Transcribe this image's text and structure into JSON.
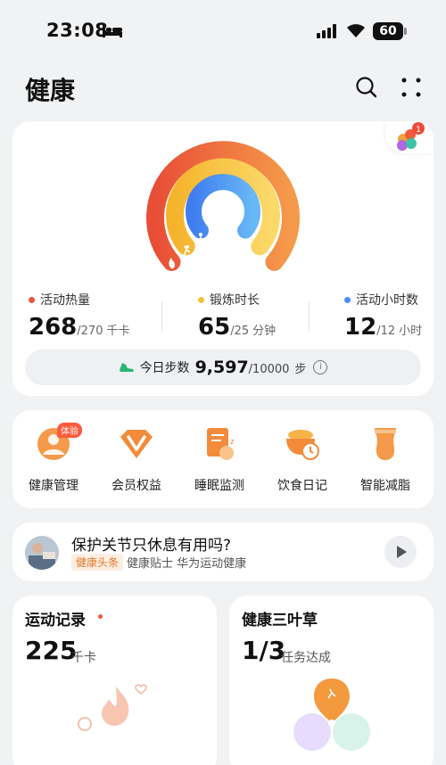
{
  "status_bar": {
    "time": "23:08",
    "battery": "60"
  },
  "header": {
    "title": "健康"
  },
  "activity": {
    "calories": {
      "label": "活动热量",
      "value": "268",
      "goal": "/270",
      "unit": "千卡",
      "color": "#e9573b"
    },
    "exercise": {
      "label": "锻炼时长",
      "value": "65",
      "goal": "/25",
      "unit": "分钟",
      "color": "#f5c33a"
    },
    "active_hours": {
      "label": "活动小时数",
      "value": "12",
      "goal": "/12",
      "unit": "小时",
      "color": "#4a8ef2"
    }
  },
  "steps": {
    "label": "今日步数",
    "value": "9,597",
    "goal": "/10000",
    "unit": "步"
  },
  "notification_badge": "1",
  "services": [
    {
      "label": "健康管理",
      "icon": "health-management-icon",
      "badge": "体验"
    },
    {
      "label": "会员权益",
      "icon": "membership-icon"
    },
    {
      "label": "睡眠监测",
      "icon": "sleep-icon"
    },
    {
      "label": "饮食日记",
      "icon": "diet-icon"
    },
    {
      "label": "智能减脂",
      "icon": "fat-loss-icon"
    }
  ],
  "news": {
    "title": "保护关节只休息有用吗?",
    "tag": "健康头条",
    "source": "健康贴士 华为运动健康"
  },
  "sport_record": {
    "title": "运动记录",
    "value": "225",
    "unit": "千卡"
  },
  "clover": {
    "title": "健康三叶草",
    "value": "1/3",
    "unit": "任务达成"
  }
}
